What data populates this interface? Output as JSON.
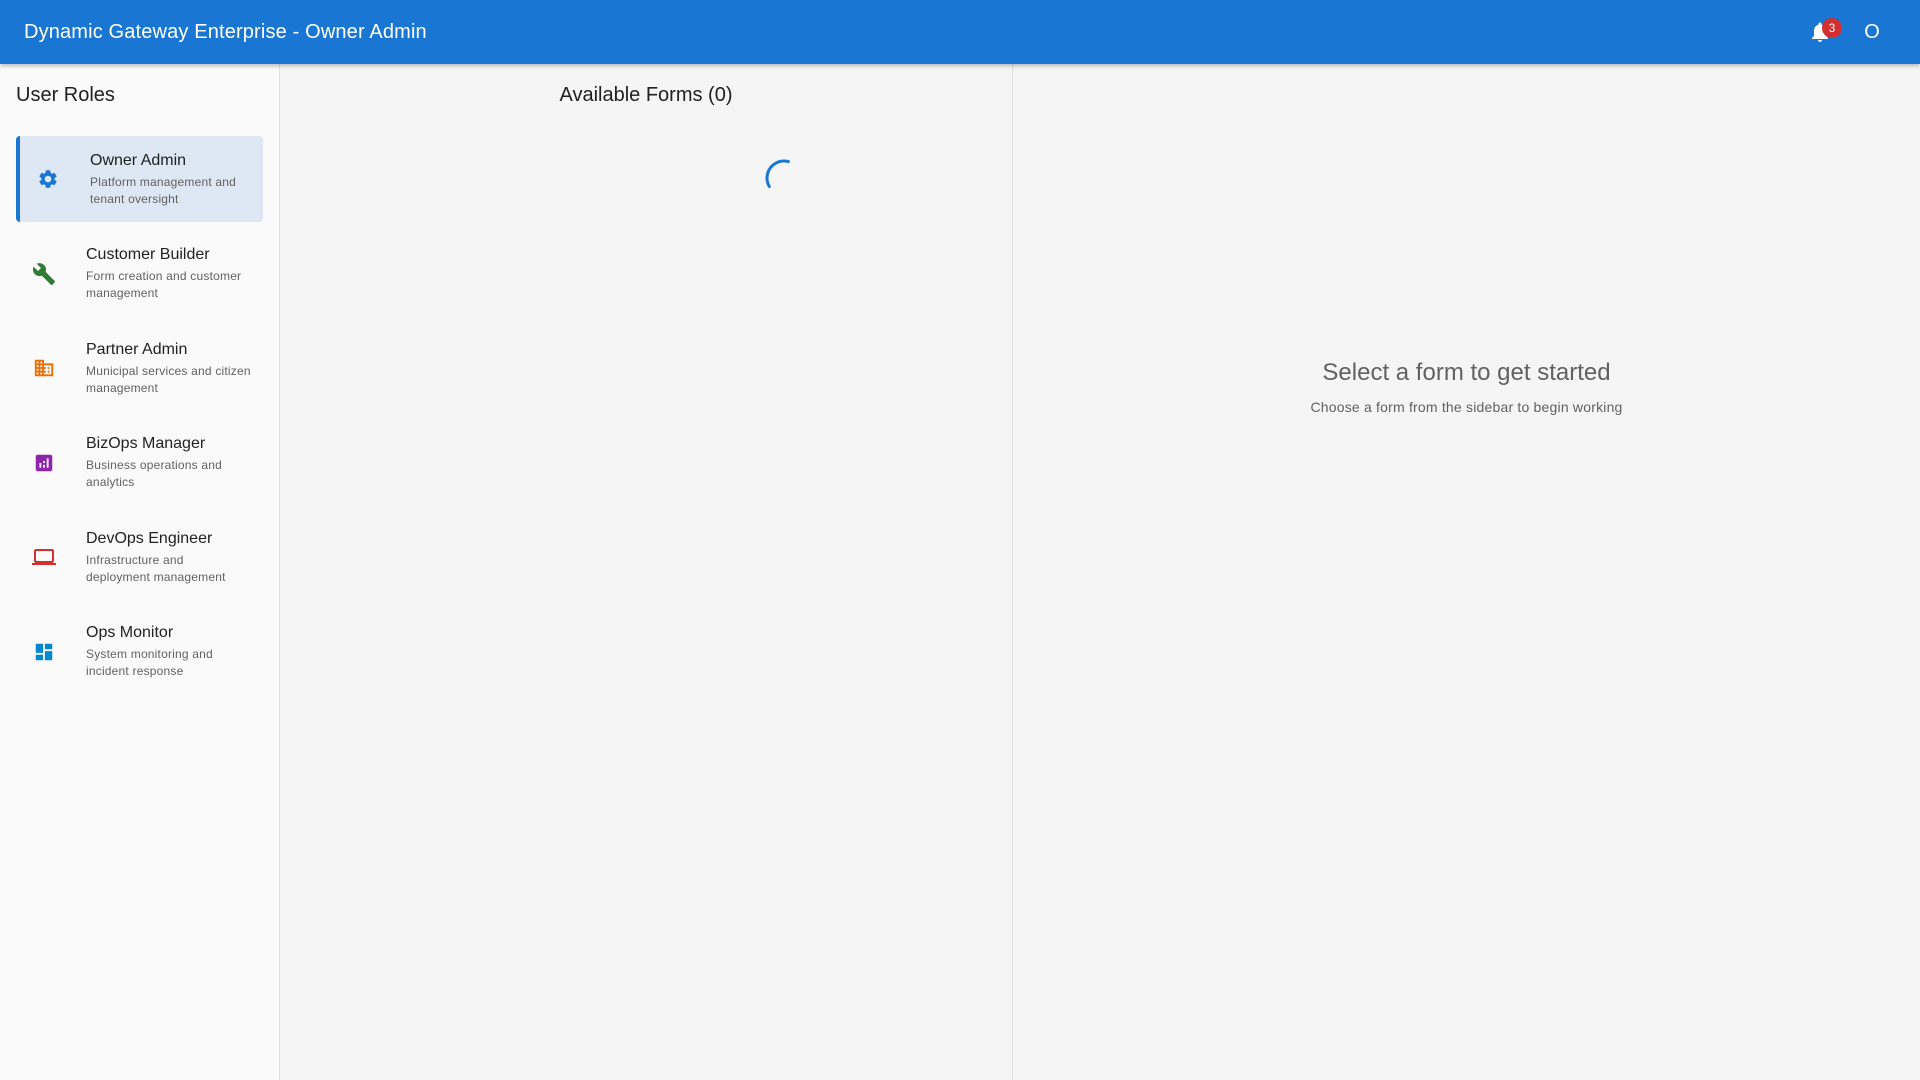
{
  "header": {
    "title": "Dynamic Gateway Enterprise - Owner Admin",
    "notification_count": "3",
    "account_initial": "O"
  },
  "sidebar": {
    "title": "User Roles",
    "items": [
      {
        "label": "Owner Admin",
        "description": "Platform management and tenant oversight",
        "icon": "gear-icon",
        "color": "#1976d2",
        "active": true
      },
      {
        "label": "Customer Builder",
        "description": "Form creation and customer management",
        "icon": "wrench-icon",
        "color": "#2e7d32"
      },
      {
        "label": "Partner Admin",
        "description": "Municipal services and citizen management",
        "icon": "building-icon",
        "color": "#ef6c00"
      },
      {
        "label": "BizOps Manager",
        "description": "Business operations and analytics",
        "icon": "analytics-icon",
        "color": "#8e24aa"
      },
      {
        "label": "DevOps Engineer",
        "description": "Infrastructure and deployment management",
        "icon": "monitor-icon",
        "color": "#d32f2f"
      },
      {
        "label": "Ops Monitor",
        "description": "System monitoring and incident response",
        "icon": "dashboard-icon",
        "color": "#0288d1"
      }
    ]
  },
  "forms": {
    "title": "Available Forms (0)"
  },
  "main": {
    "empty_title": "Select a form to get started",
    "empty_subtitle": "Choose a form from the sidebar to begin working"
  },
  "colors": {
    "primary": "#1976d2",
    "badge": "#d32f2f",
    "active_bg": "#dde8f4"
  }
}
